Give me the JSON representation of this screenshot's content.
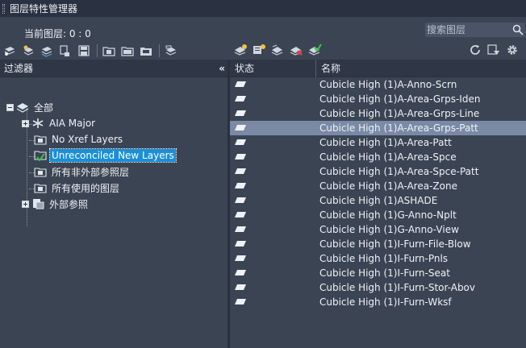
{
  "window": {
    "title": "图层特性管理器"
  },
  "current_layer": {
    "label": "当前图层: 0 : 0"
  },
  "search": {
    "placeholder": "搜索图层",
    "value": ""
  },
  "toolbar_left": {
    "icons": [
      "new-property-filter-icon",
      "new-group-filter-icon",
      "layer-states-icon",
      "layer-settings-icon",
      "save-layer-icon",
      "new-layer-icon",
      "new-vp-frozen-layer-icon",
      "delete-layer-icon",
      "set-current-icon"
    ]
  },
  "toolbar_right": {
    "icons": [
      "refresh-icon",
      "settings-dialog-icon",
      "gear-icon"
    ]
  },
  "filters": {
    "header": "过滤器",
    "collapse_glyph": "«",
    "items": [
      {
        "label": "全部"
      },
      {
        "label": "AIA Major"
      },
      {
        "label": "No Xref Layers"
      },
      {
        "label": "Unreconciled New Layers"
      },
      {
        "label": "所有非外部参照层"
      },
      {
        "label": "所有使用的图层"
      },
      {
        "label": "外部参照"
      }
    ]
  },
  "grid": {
    "columns": [
      "状态",
      "名称"
    ],
    "selected_index": 3,
    "rows": [
      {
        "name": "Cubicle High (1)A-Anno-Scrn"
      },
      {
        "name": "Cubicle High (1)A-Area-Grps-Iden"
      },
      {
        "name": "Cubicle High (1)A-Area-Grps-Line"
      },
      {
        "name": "Cubicle High (1)A-Area-Grps-Patt"
      },
      {
        "name": "Cubicle High (1)A-Area-Patt"
      },
      {
        "name": "Cubicle High (1)A-Area-Spce"
      },
      {
        "name": "Cubicle High (1)A-Area-Spce-Patt"
      },
      {
        "name": "Cubicle High (1)A-Area-Zone"
      },
      {
        "name": "Cubicle High (1)ASHADE"
      },
      {
        "name": "Cubicle High (1)G-Anno-Nplt"
      },
      {
        "name": "Cubicle High (1)G-Anno-View"
      },
      {
        "name": "Cubicle High (1)I-Furn-File-Blow"
      },
      {
        "name": "Cubicle High (1)I-Furn-Pnls"
      },
      {
        "name": "Cubicle High (1)I-Furn-Seat"
      },
      {
        "name": "Cubicle High (1)I-Furn-Stor-Abov"
      },
      {
        "name": "Cubicle High (1)I-Furn-Wksf"
      }
    ]
  },
  "colors": {
    "background": "#3b4453",
    "header": "#2f3745",
    "selection_tree": "#1a8fd6",
    "selection_row": "#7a8aa5"
  }
}
